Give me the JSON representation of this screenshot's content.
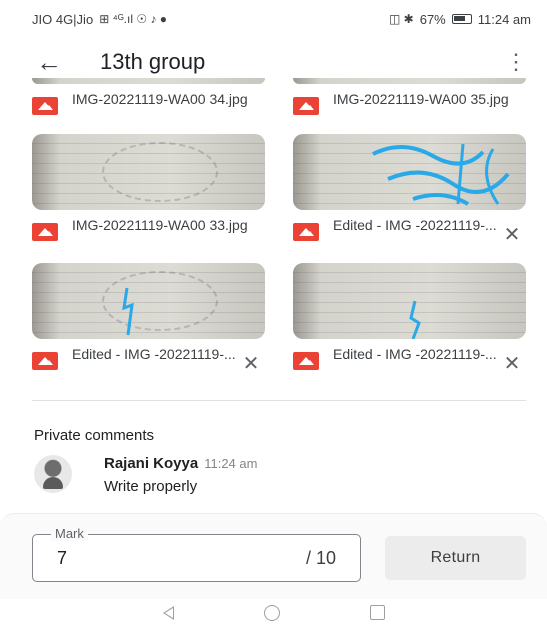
{
  "status_bar": {
    "carrier": "JIO 4G|Jio",
    "indicators": "⊞ ⁴ᴳ.ıl ☉ ♪ ●",
    "signal_icons": "◫ ✱",
    "battery": "67%",
    "time": "11:24 am"
  },
  "app_bar": {
    "back_icon": "arrow-left-icon",
    "title": "13th group",
    "more_icon": "more-vert-icon"
  },
  "attachments": [
    {
      "name": "IMG-20221119-WA00 34.jpg",
      "removable": false
    },
    {
      "name": "IMG-20221119-WA00 35.jpg",
      "removable": false
    },
    {
      "name": "IMG-20221119-WA00 33.jpg",
      "removable": false
    },
    {
      "name": "Edited - IMG -20221119-...",
      "removable": true
    },
    {
      "name": "Edited - IMG -20221119-...",
      "removable": true
    },
    {
      "name": "Edited - IMG -20221119-...",
      "removable": true
    }
  ],
  "comments": {
    "heading": "Private comments",
    "items": [
      {
        "author": "Rajani Koyya",
        "time": "11:24 am",
        "text": "Write properly"
      }
    ]
  },
  "grading": {
    "mark_label": "Mark",
    "mark_value": "7",
    "mark_total": "/ 10",
    "return_label": "Return"
  },
  "colors": {
    "image_icon": "#ea4335",
    "ink_blue": "#2aa9e8"
  }
}
